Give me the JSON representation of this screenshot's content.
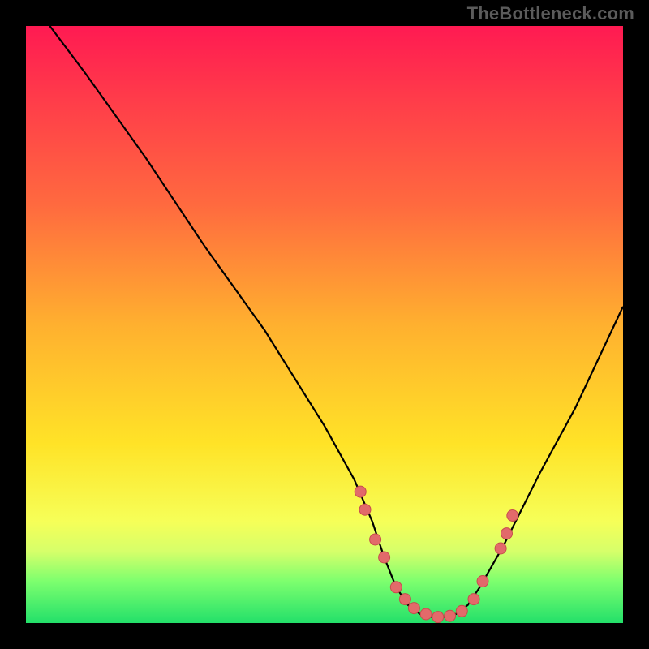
{
  "watermark": "TheBottleneck.com",
  "colors": {
    "background": "#000000",
    "text": "#5b5b5b",
    "curve": "#000000",
    "marker_fill": "#e26a6a",
    "marker_stroke": "#c74d4d",
    "gradient_stops": [
      "#ff1a52",
      "#ff3b4a",
      "#ff6a3f",
      "#ffb02f",
      "#ffe327",
      "#f6ff58",
      "#d6ff6a",
      "#7dff6e",
      "#23e06a"
    ]
  },
  "chart_data": {
    "type": "line",
    "title": "",
    "xlabel": "",
    "ylabel": "",
    "xlim": [
      0,
      100
    ],
    "ylim": [
      0,
      100
    ],
    "series": [
      {
        "name": "bottleneck-curve",
        "x": [
          4,
          10,
          20,
          30,
          40,
          50,
          55,
          58,
          60,
          62,
          64,
          66,
          68,
          70,
          72,
          74,
          76,
          80,
          86,
          92,
          100
        ],
        "y": [
          100,
          92,
          78,
          63,
          49,
          33,
          24,
          17,
          11,
          6,
          3,
          1.5,
          1,
          1,
          1.5,
          3,
          6,
          13,
          25,
          36,
          53
        ]
      }
    ],
    "markers": {
      "name": "highlight-points",
      "x": [
        56,
        56.8,
        58.5,
        60,
        62,
        63.5,
        65,
        67,
        69,
        71,
        73,
        75,
        76.5,
        79.5,
        80.5,
        81.5
      ],
      "y": [
        22,
        19,
        14,
        11,
        6,
        4,
        2.5,
        1.5,
        1,
        1.2,
        2,
        4,
        7,
        12.5,
        15,
        18
      ]
    }
  }
}
